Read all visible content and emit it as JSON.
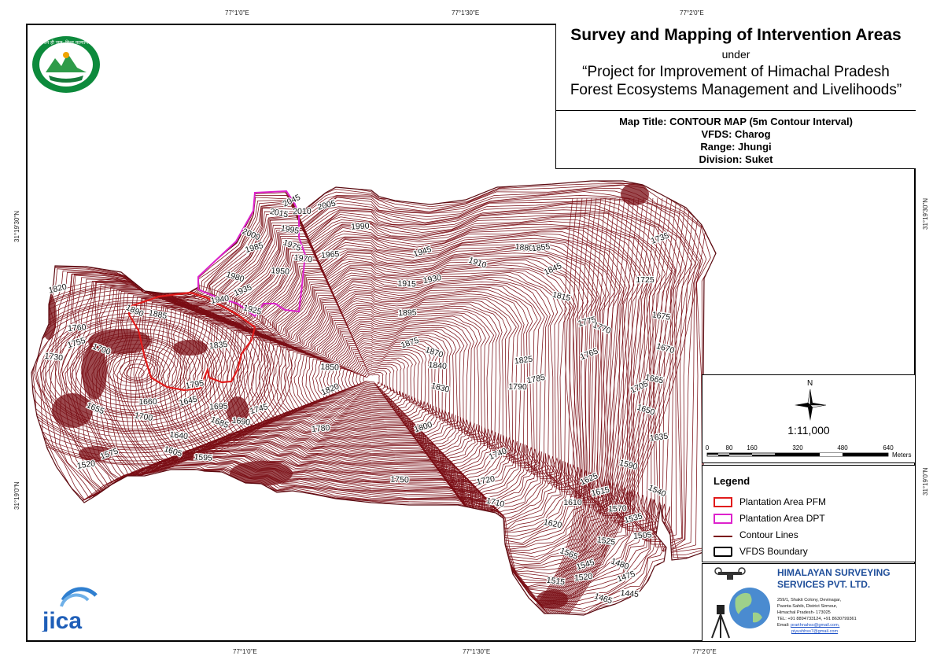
{
  "coordinates": {
    "top": [
      "77°1'0\"E",
      "77°1'30\"E",
      "77°2'0\"E"
    ],
    "bottom": [
      "77°1'0\"E",
      "77°1'30\"E",
      "77°2'0\"E"
    ],
    "left": [
      "31°19'30\"N",
      "31°19'0\"N"
    ],
    "right": [
      "31°19'30\"N",
      "31°19'0\"N"
    ]
  },
  "title": {
    "main": "Survey and Mapping of Intervention Areas",
    "under": "under",
    "project_line1": "“Project for Improvement of Himachal Pradesh",
    "project_line2": "Forest Ecosystems Management and Livelihoods”",
    "map_title": "Map Title: CONTOUR MAP (5m Contour Interval)",
    "vfds": "VFDS: Charog",
    "range": "Range: Jhungi",
    "division": "Division: Suket"
  },
  "scale": {
    "north": "N",
    "ratio": "1:11,000",
    "ticks": [
      "0",
      "80",
      "160",
      "320",
      "480",
      "640"
    ],
    "unit": "Meters"
  },
  "legend": {
    "title": "Legend",
    "items": [
      {
        "label": "Plantation Area PFM",
        "color": "#e11b1b"
      },
      {
        "label": "Plantation Area DPT",
        "color": "#dd22cc"
      },
      {
        "label": "Contour Lines",
        "color": "#7a0d14"
      },
      {
        "label": "VFDS Boundary",
        "color": "#000000"
      }
    ]
  },
  "company": {
    "name_line1": "HIMALAYAN SURVEYING",
    "name_line2": "SERVICES PVT. LTD.",
    "address": [
      "259/1, Shakti Colony, Devinagar,",
      "Paonta Sahib, District Sirmour,",
      "Himachal Pradesh- 173025",
      "TEL: +91 8894733124, +91 8630799361"
    ],
    "email_label": "Email:",
    "emails": [
      "prarthnahss@gmail.com,",
      "piyushhss7@gmail.com"
    ]
  },
  "logos": {
    "forest_dept_text": "वन ही जल, विश्व कल्याण",
    "jica": "JICA"
  },
  "colors": {
    "contour": "#7a0d14",
    "pfm": "#e11b1b",
    "dpt": "#dd22cc"
  },
  "contour_labels": [
    "2045",
    "2015",
    "2010",
    "2005",
    "2000",
    "1995",
    "1990",
    "1985",
    "1975",
    "1970",
    "1965",
    "1945",
    "1910",
    "1880",
    "1855",
    "1735",
    "1980",
    "1950",
    "1940",
    "1935",
    "1925",
    "1915",
    "1930",
    "1845",
    "1815",
    "1725",
    "1820",
    "1890",
    "1885",
    "1895",
    "1775",
    "1770",
    "1675",
    "1760",
    "1755",
    "1700",
    "1730",
    "1835",
    "1875",
    "1870",
    "1840",
    "1825",
    "1765",
    "1670",
    "1850",
    "1795",
    "1820",
    "1830",
    "1790",
    "1785",
    "1705",
    "1665",
    "1660",
    "1645",
    "1655",
    "1700",
    "1695",
    "1745",
    "1685",
    "1690",
    "1780",
    "1800",
    "1650",
    "1640",
    "1635",
    "1575",
    "1605",
    "1595",
    "1520",
    "1740",
    "1590",
    "1750",
    "1720",
    "1625",
    "1710",
    "1610",
    "1615",
    "1540",
    "1620",
    "1570",
    "1535",
    "1565",
    "1525",
    "1505",
    "1545",
    "1480",
    "1515",
    "1520",
    "1475",
    "1465",
    "1445"
  ]
}
